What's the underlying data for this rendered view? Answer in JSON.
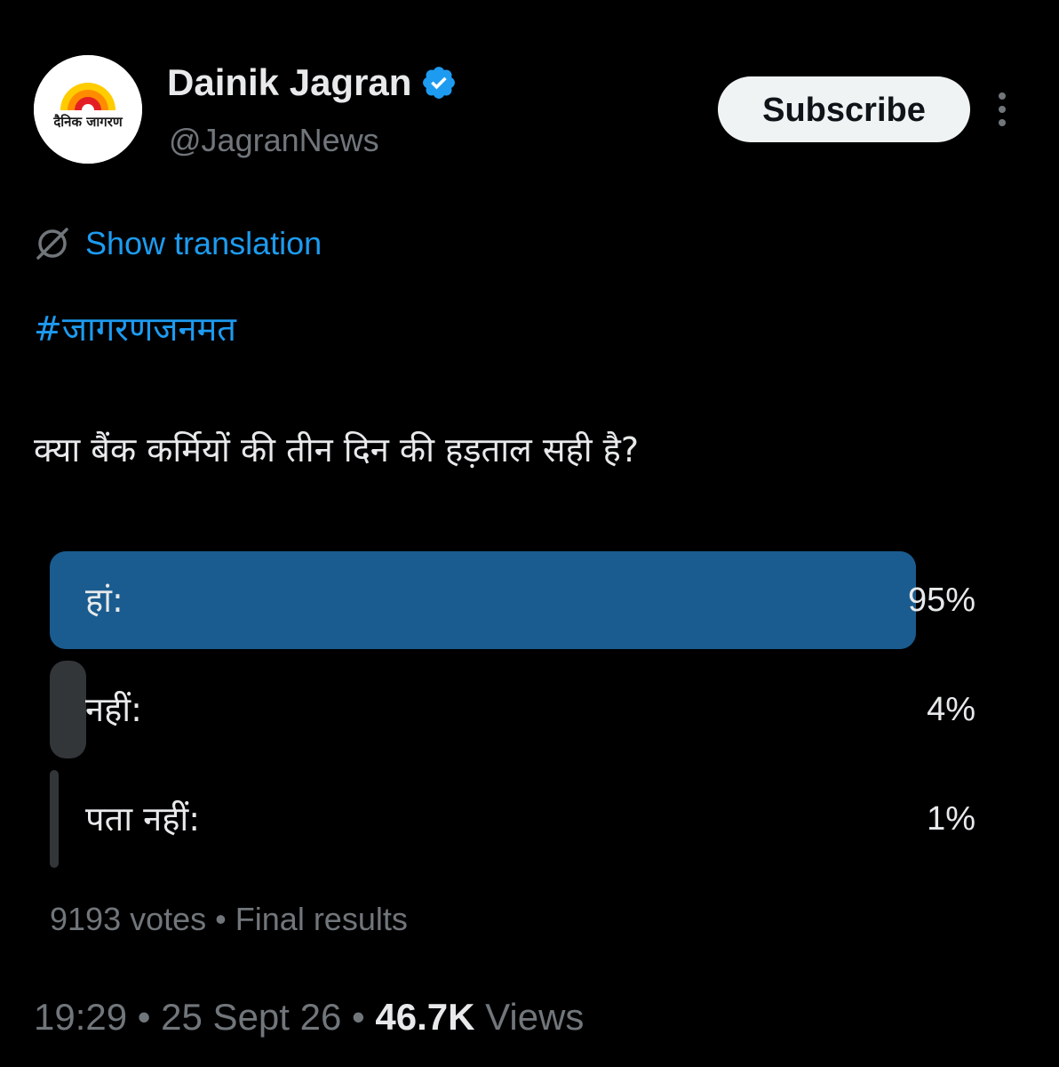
{
  "author": {
    "name": "Dainik Jagran",
    "handle": "@JagranNews",
    "logo_text": "दैनिक जागरण",
    "verified": true
  },
  "header": {
    "subscribe_label": "Subscribe",
    "more_icon": "more-vertical-icon"
  },
  "tweet": {
    "translate_label": "Show translation",
    "hashtag": "#जागरणजनमत",
    "question": "क्या बैंक कर्मियों की तीन दिन की हड़ताल सही है?"
  },
  "poll": {
    "options": [
      {
        "label": "हां:",
        "percent_label": "95%",
        "percent": 95,
        "winner": true
      },
      {
        "label": "नहीं:",
        "percent_label": "4%",
        "percent": 4,
        "winner": false
      },
      {
        "label": "पता नहीं:",
        "percent_label": "1%",
        "percent": 1,
        "winner": false
      }
    ],
    "votes": "9193 votes",
    "separator": "•",
    "status": "Final results"
  },
  "footer": {
    "time": "19:29",
    "date": "25 Sept 26",
    "views_count": "46.7K",
    "views_label": "Views",
    "separator": "•"
  },
  "colors": {
    "background": "#000000",
    "accent": "#1d9bf0",
    "winner_bar": "#1a5c8f",
    "other_bar": "#333639",
    "muted_text": "#71767b",
    "primary_text": "#e7e9ea"
  }
}
